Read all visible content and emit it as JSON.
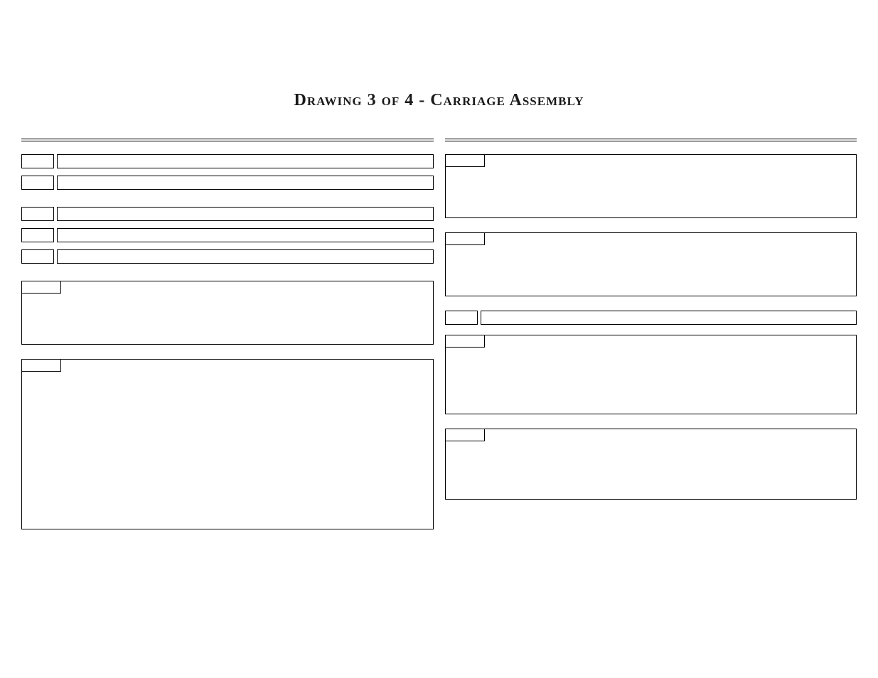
{
  "title": "Drawing 3 of 4 - Carriage Assembly",
  "left_column": {
    "group1": [
      {
        "num": "",
        "text": ""
      },
      {
        "num": "",
        "text": ""
      }
    ],
    "group2": [
      {
        "num": "",
        "text": ""
      },
      {
        "num": "",
        "text": ""
      },
      {
        "num": "",
        "text": ""
      }
    ],
    "block1": {
      "tab": "",
      "body": ""
    },
    "block2": {
      "tab": "",
      "body": ""
    }
  },
  "right_column": {
    "block1": {
      "tab": "",
      "body": ""
    },
    "block2": {
      "tab": "",
      "body": ""
    },
    "row3": {
      "num": "",
      "text": ""
    },
    "block4": {
      "tab": "",
      "body": ""
    },
    "block5": {
      "tab": "",
      "body": ""
    }
  }
}
